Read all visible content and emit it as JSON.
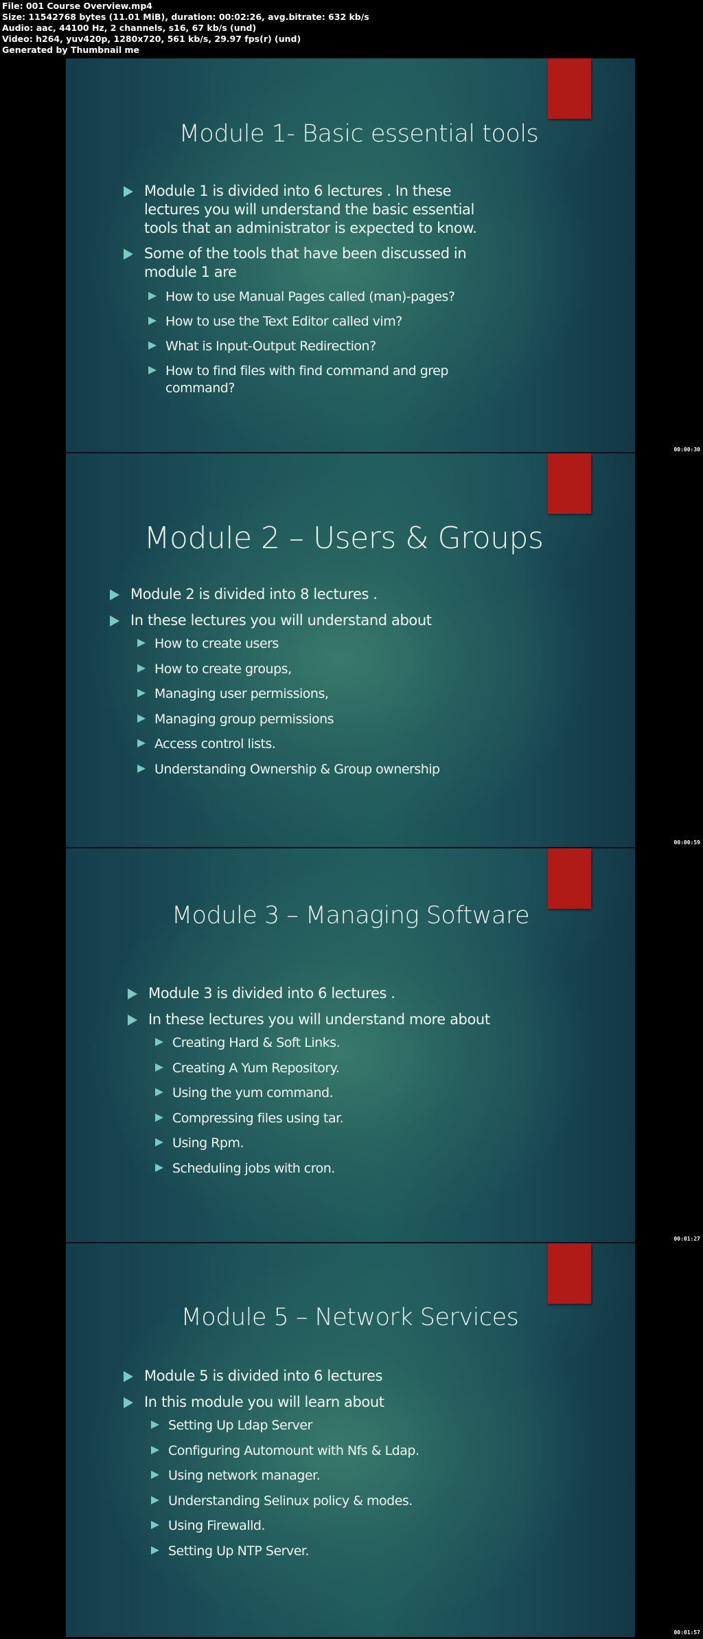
{
  "file_info": {
    "file": "File: 001 Course Overview.mp4",
    "size": "Size: 11542768 bytes (11.01 MiB), duration: 00:02:26, avg.bitrate: 632 kb/s",
    "audio": "Audio: aac, 44100 Hz, 2 channels, s16, 67 kb/s (und)",
    "video": "Video: h264, yuv420p, 1280x720, 561 kb/s, 29.97 fps(r) (und)",
    "generator": "Generated by Thumbnail me"
  },
  "colors": {
    "accent_red": "#b01a17",
    "bullet_arrow": "#7ec8c4",
    "slide_bg": "#1f5a5c"
  },
  "slides": [
    {
      "timestamp": "00:00:30",
      "title": "Module 1- Basic essential tools",
      "bullets": [
        {
          "level": 1,
          "text": "Module 1 is divided  into 6 lectures . In these lectures you will understand the basic essential tools that an administrator is expected to know."
        },
        {
          "level": 1,
          "text": "Some of the tools that have been discussed in module 1 are"
        },
        {
          "level": 2,
          "text": "How to use Manual Pages called (man)-pages?"
        },
        {
          "level": 2,
          "text": "How to use the Text Editor called vim?"
        },
        {
          "level": 2,
          "text": "What is Input-Output Redirection?"
        },
        {
          "level": 2,
          "text": "How to find files with find command and grep command?"
        }
      ]
    },
    {
      "timestamp": "00:00:59",
      "title": "Module 2 – Users & Groups",
      "bullets": [
        {
          "level": 1,
          "text": "Module 2 is divided into 8 lectures ."
        },
        {
          "level": 1,
          "text": "In these lectures you will understand about"
        },
        {
          "level": 2,
          "text": "How to create users"
        },
        {
          "level": 2,
          "text": "How to create groups,"
        },
        {
          "level": 2,
          "text": "Managing user permissions,"
        },
        {
          "level": 2,
          "text": "Managing group permissions"
        },
        {
          "level": 2,
          "text": "Access control lists."
        },
        {
          "level": 2,
          "text": "Understanding Ownership & Group ownership"
        }
      ]
    },
    {
      "timestamp": "00:01:27",
      "title": "Module 3 – Managing Software",
      "bullets": [
        {
          "level": 1,
          "text": "Module 3 is divided  into 6 lectures ."
        },
        {
          "level": 1,
          "text": "In these lectures you will understand  more about"
        },
        {
          "level": 2,
          "text": "Creating Hard & Soft Links."
        },
        {
          "level": 2,
          "text": "Creating A Yum Repository."
        },
        {
          "level": 2,
          "text": "Using the yum command."
        },
        {
          "level": 2,
          "text": "Compressing files using tar."
        },
        {
          "level": 2,
          "text": "Using Rpm."
        },
        {
          "level": 2,
          "text": "Scheduling jobs with cron."
        }
      ]
    },
    {
      "timestamp": "00:01:57",
      "title": "Module 5 – Network Services",
      "bullets": [
        {
          "level": 1,
          "text": "Module 5 is divided into 6 lectures"
        },
        {
          "level": 1,
          "text": "In this module you will learn about"
        },
        {
          "level": 2,
          "text": "Setting Up Ldap Server"
        },
        {
          "level": 2,
          "text": "Configuring Automount with Nfs & Ldap."
        },
        {
          "level": 2,
          "text": "Using network manager."
        },
        {
          "level": 2,
          "text": "Understanding Selinux policy & modes."
        },
        {
          "level": 2,
          "text": "Using Firewalld."
        },
        {
          "level": 2,
          "text": "Setting Up NTP Server."
        }
      ]
    }
  ]
}
